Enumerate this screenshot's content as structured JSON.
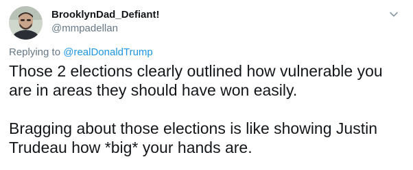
{
  "tweet": {
    "author": {
      "display_name": "BrooklynDad_Defiant!",
      "handle": "@mmpadellan",
      "avatar": "avatar-photo"
    },
    "menu_icon": "chevron-down-icon",
    "reply_context": {
      "prefix": "Replying to ",
      "mention": "@realDonaldTrump"
    },
    "paragraphs": [
      "Those 2 elections clearly outlined how vulnerable you\nare in areas they should have won easily.",
      "Bragging about those elections is like showing Justin\nTrudeau how *big* your hands are."
    ]
  }
}
